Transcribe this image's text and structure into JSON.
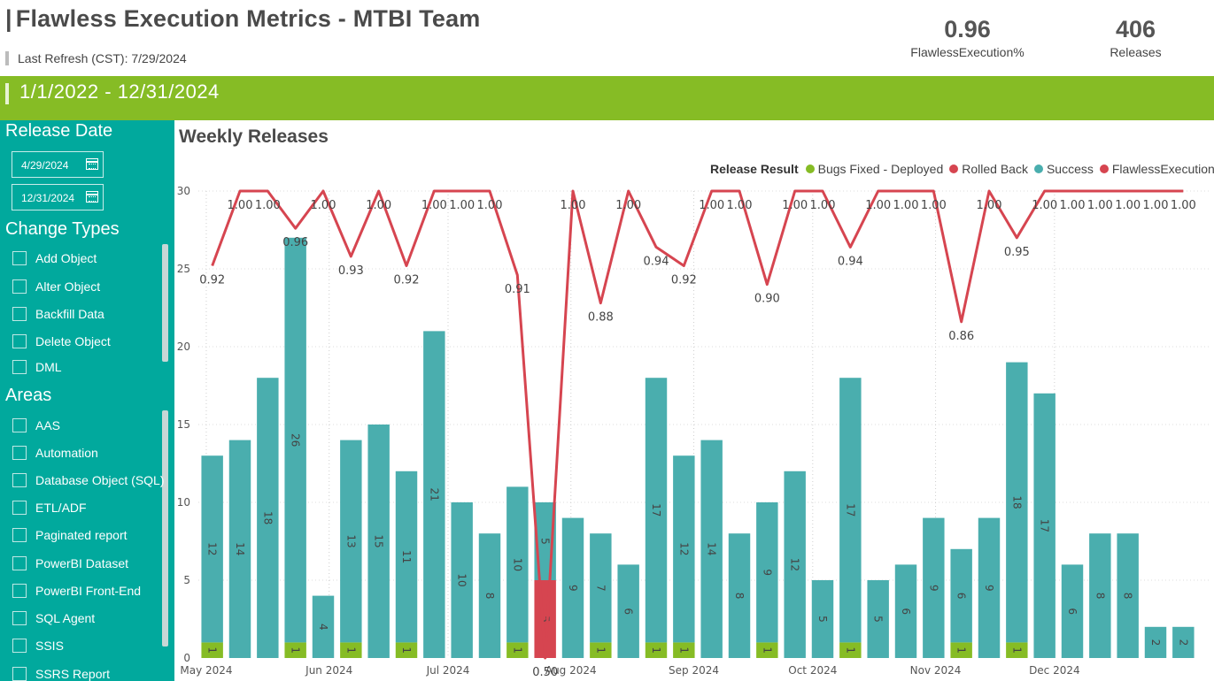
{
  "header": {
    "title": "Flawless Execution Metrics - MTBI Team",
    "last_refresh": "Last Refresh (CST): 7/29/2024",
    "kpis": [
      {
        "value": "0.96",
        "label": "FlawlessExecution%"
      },
      {
        "value": "406",
        "label": "Releases"
      }
    ]
  },
  "date_range": "1/1/2022 - 12/31/2024",
  "filters": {
    "release_date": {
      "title": "Release Date",
      "start": "4/29/2024",
      "end": "12/31/2024"
    },
    "change_types": {
      "title": "Change Types",
      "options": [
        "Add Object",
        "Alter Object",
        "Backfill Data",
        "Delete Object",
        "DML"
      ]
    },
    "areas": {
      "title": "Areas",
      "options": [
        "AAS",
        "Automation",
        "Database Object (SQL)",
        "ETL/ADF",
        "Paginated report",
        "PowerBI Dataset",
        "PowerBI Front-End",
        "SQL Agent",
        "SSIS",
        "SSRS Report"
      ]
    }
  },
  "chart_title": "Weekly Releases",
  "colors": {
    "bugs_fixed": "#86bc25",
    "rolled_back": "#d64550",
    "success": "#4aaeae",
    "flawless_line": "#d64550",
    "panel": "#01a99d"
  },
  "chart_data": {
    "type": "bar",
    "stacked": true,
    "title": "Weekly Releases",
    "legend_title": "Release Result",
    "legend": [
      "Bugs Fixed - Deployed",
      "Rolled Back",
      "Success",
      "FlawlessExecution%"
    ],
    "legend_position": "top-right",
    "ylim": [
      0,
      30
    ],
    "y_ticks": [
      "0",
      "5",
      "10",
      "15",
      "20",
      "25",
      "30"
    ],
    "x_tick_labels": [
      "May 2024",
      "Jun 2024",
      "Jul 2024",
      "Aug 2024",
      "Sep 2024",
      "Oct 2024",
      "Nov 2024",
      "Dec 2024"
    ],
    "weeks": [
      "2024-04-29",
      "2024-05-06",
      "2024-05-13",
      "2024-05-20",
      "2024-05-27",
      "2024-06-03",
      "2024-06-10",
      "2024-06-17",
      "2024-06-24",
      "2024-07-01",
      "2024-07-08",
      "2024-07-15",
      "2024-07-22",
      "2024-07-29",
      "2024-08-05",
      "2024-08-12",
      "2024-08-19",
      "2024-08-26",
      "2024-09-02",
      "2024-09-09",
      "2024-09-16",
      "2024-09-23",
      "2024-09-30",
      "2024-10-07",
      "2024-10-14",
      "2024-10-21",
      "2024-10-28",
      "2024-11-04",
      "2024-11-11",
      "2024-11-18",
      "2024-11-25",
      "2024-12-02",
      "2024-12-09",
      "2024-12-16",
      "2024-12-23",
      "2024-12-30"
    ],
    "series": [
      {
        "name": "Bugs Fixed - Deployed",
        "values": [
          1,
          0,
          0,
          1,
          0,
          1,
          0,
          1,
          0,
          0,
          0,
          1,
          0,
          0,
          1,
          0,
          1,
          1,
          0,
          0,
          1,
          0,
          0,
          1,
          0,
          0,
          0,
          1,
          0,
          1,
          0,
          0,
          0,
          0,
          0,
          0
        ]
      },
      {
        "name": "Rolled Back",
        "values": [
          0,
          0,
          0,
          0,
          0,
          0,
          0,
          0,
          0,
          0,
          0,
          0,
          5,
          0,
          0,
          0,
          0,
          0,
          0,
          0,
          0,
          0,
          0,
          0,
          0,
          0,
          0,
          0,
          0,
          0,
          0,
          0,
          0,
          0,
          0,
          0
        ]
      },
      {
        "name": "Success",
        "values": [
          12,
          14,
          18,
          26,
          4,
          13,
          15,
          11,
          21,
          10,
          8,
          10,
          5,
          9,
          7,
          6,
          17,
          12,
          14,
          8,
          9,
          12,
          5,
          17,
          5,
          6,
          9,
          6,
          9,
          18,
          17,
          6,
          8,
          8,
          2,
          2
        ]
      },
      {
        "name": "FlawlessExecution%",
        "values": [
          0.92,
          1.0,
          1.0,
          0.96,
          1.0,
          0.93,
          1.0,
          0.92,
          1.0,
          1.0,
          1.0,
          0.91,
          0.5,
          1.0,
          0.88,
          1.0,
          0.94,
          0.92,
          1.0,
          1.0,
          0.9,
          1.0,
          1.0,
          0.94,
          1.0,
          1.0,
          1.0,
          0.86,
          1.0,
          0.95,
          1.0,
          1.0,
          1.0,
          1.0,
          1.0,
          1.0
        ]
      }
    ]
  }
}
